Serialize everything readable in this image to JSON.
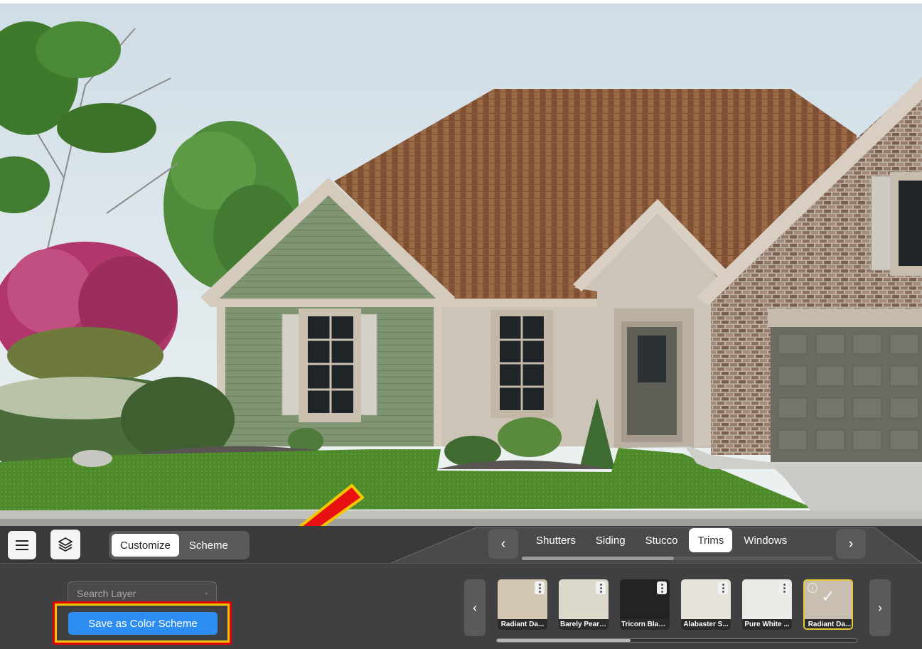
{
  "toolbar": {
    "menu_icon": "hamburger-menu-icon",
    "layers_icon": "layers-icon",
    "mode_tabs": [
      {
        "label": "Customize",
        "active": true
      },
      {
        "label": "Scheme",
        "active": false
      }
    ]
  },
  "category_tabs": {
    "items": [
      {
        "label": "Shutters",
        "active": false
      },
      {
        "label": "Siding",
        "active": false
      },
      {
        "label": "Stucco",
        "active": false
      },
      {
        "label": "Trims",
        "active": true
      },
      {
        "label": "Windows",
        "active": false
      }
    ],
    "prev_icon": "chevron-left-icon",
    "next_icon": "chevron-right-icon"
  },
  "search": {
    "placeholder": "Search Layer",
    "icon": "search-icon"
  },
  "save_scheme": {
    "label": "Save as Color Scheme"
  },
  "swatches": {
    "items": [
      {
        "name": "Radiant Da...",
        "color": "#d3c6b3",
        "selected": false
      },
      {
        "name": "Barely Pear ...",
        "color": "#dcd9cb",
        "selected": false
      },
      {
        "name": "Tricorn Blac...",
        "color": "#232323",
        "selected": false
      },
      {
        "name": "Alabaster S...",
        "color": "#e6e3da",
        "selected": false
      },
      {
        "name": "Pure White ...",
        "color": "#ebeae6",
        "selected": false
      },
      {
        "name": "Radiant Da...",
        "color": "#c8bfb1",
        "selected": true
      }
    ]
  },
  "colors": {
    "accent": "#2e8df0",
    "highlight_yellow": "#f4c400",
    "highlight_red": "#e30000",
    "siding_green": "#7f9572",
    "stucco_beige": "#cdc4b8",
    "roof_brown": "#8a5a3a",
    "brick": "#8a6f5e",
    "garage": "#6b6b62"
  }
}
